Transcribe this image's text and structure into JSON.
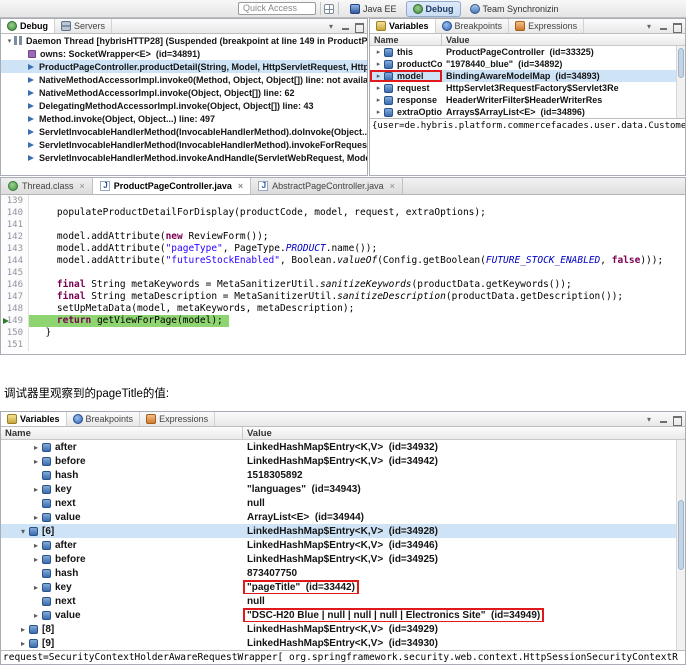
{
  "colors": {
    "selection": "#cfe3f6",
    "current_line": "#8ed470",
    "annotation_red": "#e01a1a",
    "keyword": "#7b0052",
    "string": "#2a00ff"
  },
  "topbar": {
    "quick_access_label": "Quick Access",
    "perspectives": [
      {
        "label": "Java EE",
        "icon": "javaee",
        "active": false
      },
      {
        "label": "Debug",
        "icon": "debug",
        "active": true
      },
      {
        "label": "Team Synchronizin",
        "icon": "team",
        "active": false
      }
    ]
  },
  "debug_panel": {
    "tabs": [
      {
        "label": "Debug",
        "icon": "debug",
        "active": true
      },
      {
        "label": "Servers",
        "icon": "servers",
        "active": false
      }
    ],
    "rows": [
      {
        "text": "Daemon Thread [hybrisHTTP28] (Suspended (breakpoint at line 149 in ProductPage",
        "level": 0,
        "icon": "thread",
        "expander": "open",
        "selected": false
      },
      {
        "text": "owns: SocketWrapper<E>  (id=34891)",
        "level": 1,
        "icon": "monitor",
        "expander": "",
        "selected": false
      },
      {
        "text": "ProductPageController.productDetail(String, Model, HttpServletRequest, HttpSer",
        "level": 1,
        "icon": "frame",
        "expander": "",
        "selected": true
      },
      {
        "text": "NativeMethodAccessorImpl.invoke0(Method, Object, Object[]) line: not available",
        "level": 1,
        "icon": "frame",
        "expander": "",
        "selected": false
      },
      {
        "text": "NativeMethodAccessorImpl.invoke(Object, Object[]) line: 62",
        "level": 1,
        "icon": "frame",
        "expander": "",
        "selected": false
      },
      {
        "text": "DelegatingMethodAccessorImpl.invoke(Object, Object[]) line: 43",
        "level": 1,
        "icon": "frame",
        "expander": "",
        "selected": false
      },
      {
        "text": "Method.invoke(Object, Object...) line: 497",
        "level": 1,
        "icon": "frame",
        "expander": "",
        "selected": false
      },
      {
        "text": "ServletInvocableHandlerMethod(InvocableHandlerMethod).doInvoke(Object...) li",
        "level": 1,
        "icon": "frame",
        "expander": "",
        "selected": false
      },
      {
        "text": "ServletInvocableHandlerMethod(InvocableHandlerMethod).invokeForRequest(N",
        "level": 1,
        "icon": "frame",
        "expander": "",
        "selected": false
      },
      {
        "text": "ServletInvocableHandlerMethod.invokeAndHandle(ServletWebRequest, ModelAn",
        "level": 1,
        "icon": "frame",
        "expander": "",
        "selected": false
      }
    ]
  },
  "variables_panel": {
    "tabs": [
      {
        "label": "Variables",
        "icon": "variables",
        "active": true
      },
      {
        "label": "Breakpoints",
        "icon": "breakpoints",
        "active": false
      },
      {
        "label": "Expressions",
        "icon": "expressions",
        "active": false
      }
    ],
    "columns": [
      "Name",
      "Value"
    ],
    "rows": [
      {
        "name": "this",
        "value": "ProductPageController  (id=33325)",
        "level": 0,
        "expander": "closed",
        "icon": "var",
        "selected": false
      },
      {
        "name": "productCode",
        "value": "\"1978440_blue\"  (id=34892)",
        "level": 0,
        "expander": "closed",
        "icon": "var",
        "selected": false
      },
      {
        "name": "model",
        "value": "BindingAwareModelMap  (id=34893)",
        "level": 0,
        "expander": "closed",
        "icon": "var",
        "selected": true,
        "redbox_name": true
      },
      {
        "name": "request",
        "value": "HttpServlet3RequestFactory$Servlet3Re",
        "level": 0,
        "expander": "closed",
        "icon": "var",
        "selected": false
      },
      {
        "name": "response",
        "value": "HeaderWriterFilter$HeaderWriterRes",
        "level": 0,
        "expander": "closed",
        "icon": "var",
        "selected": false
      },
      {
        "name": "extraOptions",
        "value": "Arrays$ArrayList<E>  (id=34896)",
        "level": 0,
        "expander": "closed",
        "icon": "var",
        "selected": false
      }
    ],
    "detail": "{user=de.hybris.platform.commercefacades.user.data.CustomerData@"
  },
  "editor": {
    "tabs": [
      {
        "label": "Thread.class",
        "icon": "class",
        "active": false
      },
      {
        "label": "ProductPageController.java",
        "icon": "java",
        "active": true
      },
      {
        "label": "AbstractPageController.java",
        "icon": "java",
        "active": false
      }
    ],
    "lines": [
      {
        "no": "139",
        "tokens": []
      },
      {
        "no": "140",
        "tokens": [
          [
            "p",
            "    populateProductDetailForDisplay(productCode, model, request, extraOptions);"
          ]
        ]
      },
      {
        "no": "141",
        "tokens": []
      },
      {
        "no": "142",
        "tokens": [
          [
            "p",
            "    model.addAttribute("
          ],
          [
            "k",
            "new"
          ],
          [
            "p",
            " ReviewForm());"
          ]
        ]
      },
      {
        "no": "143",
        "tokens": [
          [
            "p",
            "    model.addAttribute("
          ],
          [
            "s",
            "\"pageType\""
          ],
          [
            "p",
            ", PageType."
          ],
          [
            "st",
            "PRODUCT"
          ],
          [
            "p",
            ".name());"
          ]
        ]
      },
      {
        "no": "144",
        "tokens": [
          [
            "p",
            "    model.addAttribute("
          ],
          [
            "s",
            "\"futureStockEnabled\""
          ],
          [
            "p",
            ", Boolean."
          ],
          [
            "sm",
            "valueOf"
          ],
          [
            "p",
            "(Config.getBoolean("
          ],
          [
            "st",
            "FUTURE_STOCK_ENABLED"
          ],
          [
            "p",
            ", "
          ],
          [
            "k",
            "false"
          ],
          [
            "p",
            ")));"
          ]
        ]
      },
      {
        "no": "145",
        "tokens": []
      },
      {
        "no": "146",
        "tokens": [
          [
            "p",
            "    "
          ],
          [
            "k",
            "final"
          ],
          [
            "p",
            " String metaKeywords = MetaSanitizerUtil."
          ],
          [
            "sm",
            "sanitizeKeywords"
          ],
          [
            "p",
            "(productData.getKeywords());"
          ]
        ]
      },
      {
        "no": "147",
        "tokens": [
          [
            "p",
            "    "
          ],
          [
            "k",
            "final"
          ],
          [
            "p",
            " String metaDescription = MetaSanitizerUtil."
          ],
          [
            "sm",
            "sanitizeDescription"
          ],
          [
            "p",
            "(productData.getDescription());"
          ]
        ]
      },
      {
        "no": "148",
        "tokens": [
          [
            "p",
            "    setUpMetaData(model, metaKeywords, metaDescription);"
          ]
        ]
      },
      {
        "no": "149",
        "current": true,
        "tokens": [
          [
            "p",
            "    "
          ],
          [
            "k",
            "return"
          ],
          [
            "p",
            " getViewForPage(model);"
          ]
        ]
      },
      {
        "no": "150",
        "tokens": [
          [
            "p",
            "  }"
          ]
        ]
      },
      {
        "no": "151",
        "tokens": []
      }
    ]
  },
  "annotation": "调试器里观察到的pageTitle的值:",
  "bottom_panel": {
    "tabs": [
      {
        "label": "Variables",
        "icon": "variables",
        "active": true
      },
      {
        "label": "Breakpoints",
        "icon": "breakpoints",
        "active": false
      },
      {
        "label": "Expressions",
        "icon": "expressions",
        "active": false
      }
    ],
    "columns": [
      "Name",
      "Value"
    ],
    "rows": [
      {
        "name": "after",
        "value": "LinkedHashMap$Entry<K,V>  (id=34932)",
        "level": 2,
        "expander": "closed",
        "icon": "var",
        "selected": false
      },
      {
        "name": "before",
        "value": "LinkedHashMap$Entry<K,V>  (id=34942)",
        "level": 2,
        "expander": "closed",
        "icon": "var",
        "selected": false
      },
      {
        "name": "hash",
        "value": "1518305892",
        "level": 2,
        "expander": "",
        "icon": "var",
        "selected": false
      },
      {
        "name": "key",
        "value": "\"languages\"  (id=34943)",
        "level": 2,
        "expander": "closed",
        "icon": "var",
        "selected": false
      },
      {
        "name": "next",
        "value": "null",
        "level": 2,
        "expander": "",
        "icon": "var",
        "selected": false
      },
      {
        "name": "value",
        "value": "ArrayList<E>  (id=34944)",
        "level": 2,
        "expander": "closed",
        "icon": "var",
        "selected": false
      },
      {
        "name": "[6]",
        "value": "LinkedHashMap$Entry<K,V>  (id=34928)",
        "level": 1,
        "expander": "open",
        "icon": "var",
        "selected": true
      },
      {
        "name": "after",
        "value": "LinkedHashMap$Entry<K,V>  (id=34946)",
        "level": 2,
        "expander": "closed",
        "icon": "var",
        "selected": false
      },
      {
        "name": "before",
        "value": "LinkedHashMap$Entry<K,V>  (id=34925)",
        "level": 2,
        "expander": "closed",
        "icon": "var",
        "selected": false
      },
      {
        "name": "hash",
        "value": "873407750",
        "level": 2,
        "expander": "",
        "icon": "var",
        "selected": false
      },
      {
        "name": "key",
        "value": "\"pageTitle\"  (id=33442)",
        "level": 2,
        "expander": "closed",
        "icon": "var",
        "selected": false,
        "redbox_value": true
      },
      {
        "name": "next",
        "value": "null",
        "level": 2,
        "expander": "",
        "icon": "var",
        "selected": false
      },
      {
        "name": "value",
        "value": "\"DSC-H20 Blue | null | null | null | Electronics Site\"  (id=34949)",
        "level": 2,
        "expander": "closed",
        "icon": "var",
        "selected": false,
        "redbox_value": true
      },
      {
        "name": "[8]",
        "value": "LinkedHashMap$Entry<K,V>  (id=34929)",
        "level": 1,
        "expander": "closed",
        "icon": "var",
        "selected": false
      },
      {
        "name": "[9]",
        "value": "LinkedHashMap$Entry<K,V>  (id=34930)",
        "level": 1,
        "expander": "closed",
        "icon": "var",
        "selected": false
      }
    ],
    "detail": "request=SecurityContextHolderAwareRequestWrapper[ org.springframework.security.web.context.HttpSessionSecurityContextR"
  }
}
